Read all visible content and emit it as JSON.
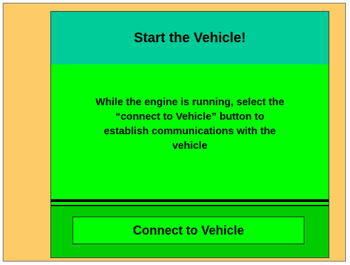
{
  "header": {
    "title": "Start the Vehicle!"
  },
  "message": {
    "lines": [
      "While the engine is running, select the",
      "“connect to Vehicle” button to",
      "establish communications with the",
      "vehicle"
    ]
  },
  "footer": {
    "connect_label": "Connect to Vehicle"
  },
  "colors": {
    "background": "#fdcc66",
    "header": "#00cc99",
    "panel": "#00ff00",
    "footer": "#00cc00",
    "button": "#00ff00"
  }
}
